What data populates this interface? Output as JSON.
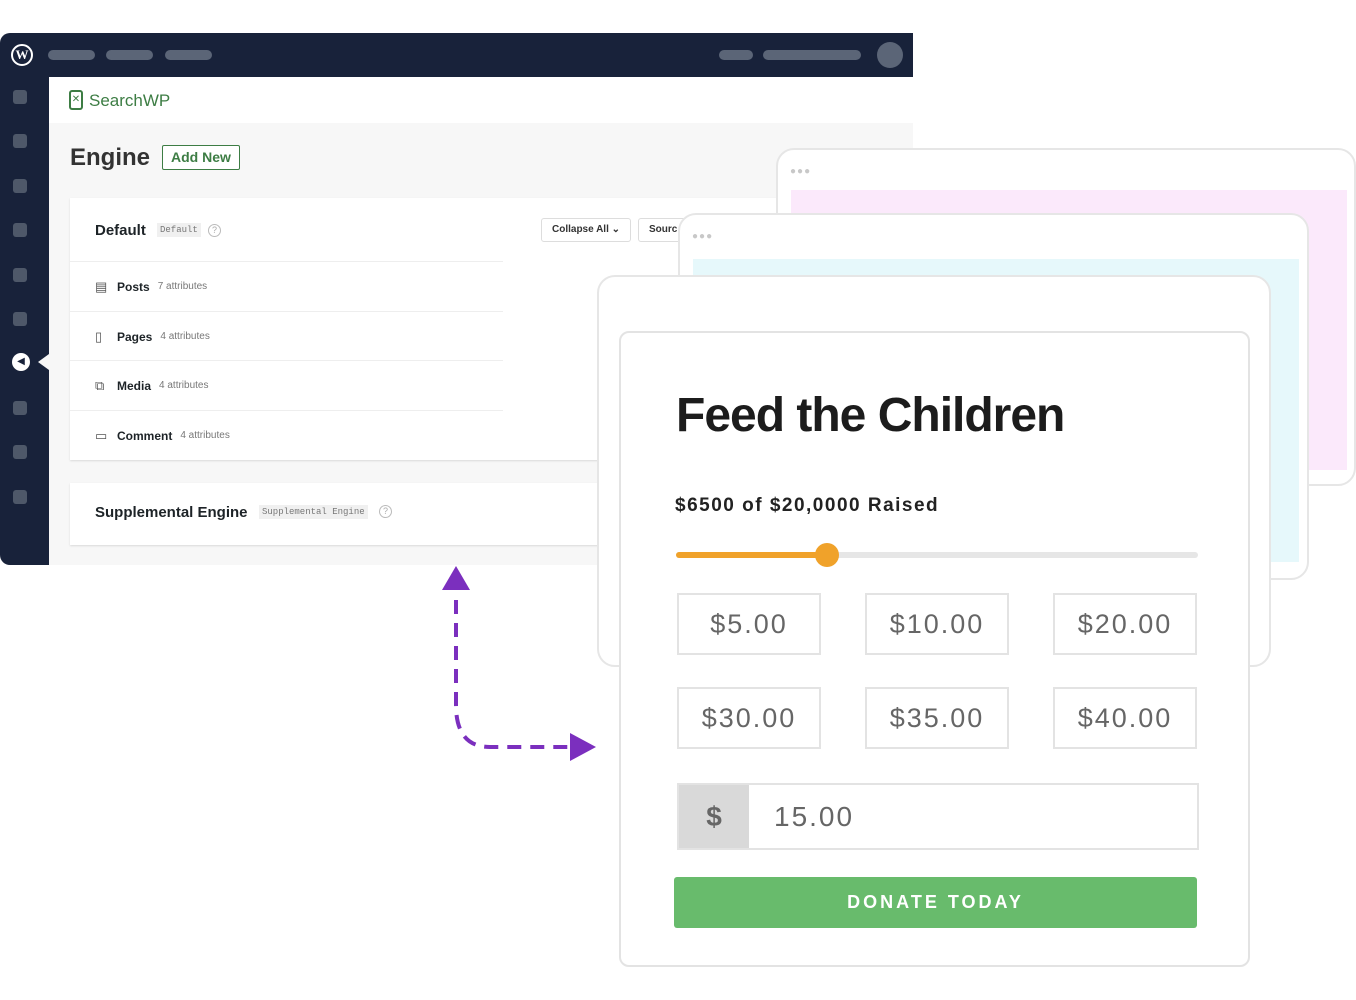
{
  "brand": "SearchWP",
  "page": {
    "title": "Engine",
    "add_new": "Add New"
  },
  "default_engine": {
    "name": "Default",
    "slug": "Default",
    "collapse_all": "Collapse All",
    "sources": "Sourc",
    "sources_list": [
      {
        "label": "Posts",
        "count": "7 attributes",
        "icon": "post-icon"
      },
      {
        "label": "Pages",
        "count": "4 attributes",
        "icon": "page-icon"
      },
      {
        "label": "Media",
        "count": "4 attributes",
        "icon": "media-icon"
      },
      {
        "label": "Comment",
        "count": "4 attributes",
        "icon": "comment-icon"
      }
    ]
  },
  "supplemental_engine": {
    "name": "Supplemental Engine",
    "slug": "Supplemental Engine"
  },
  "donation": {
    "title": "Feed the Children",
    "raised_text": "$6500 of $20,0000 Raised",
    "progress_percent": 29,
    "amounts": [
      "$5.00",
      "$10.00",
      "$20.00",
      "$30.00",
      "$35.00",
      "$40.00"
    ],
    "currency_symbol": "$",
    "custom_amount": "15.00",
    "donate_label": "DONATE TODAY"
  },
  "colors": {
    "wp_dark": "#18223a",
    "brand_green": "#3d7d44",
    "progress": "#f0a22a",
    "donate": "#68bb6c",
    "arrow": "#7b2fbe",
    "pink": "#fbe9fb",
    "cyan": "#e6f8fb"
  }
}
